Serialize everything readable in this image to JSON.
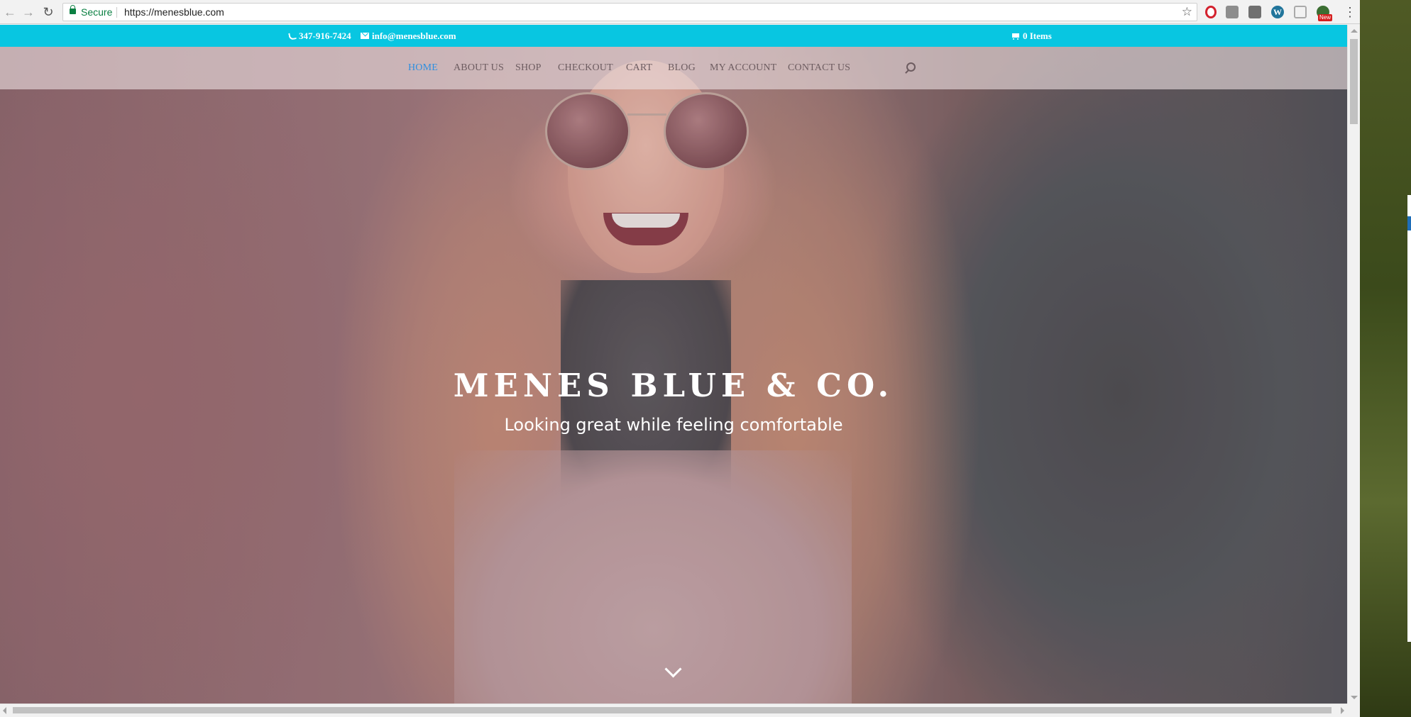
{
  "browser": {
    "secure_label": "Secure",
    "url": "https://menesblue.com",
    "extensions": [
      "opera-icon",
      "extension-icon",
      "extension-icon",
      "wordpress-icon",
      "extension-icon",
      "extension-icon"
    ],
    "new_badge": "New"
  },
  "topbar": {
    "phone": "347-916-7424",
    "email": "info@menesblue.com",
    "cart": "0 Items",
    "color": "#08c6e1"
  },
  "nav": {
    "items": [
      {
        "label": "HOME",
        "current": true
      },
      {
        "label": "ABOUT US"
      },
      {
        "label": "SHOP"
      },
      {
        "label": "CHECKOUT"
      },
      {
        "label": "CART"
      },
      {
        "label": "BLOG"
      },
      {
        "label": "MY ACCOUNT"
      },
      {
        "label": "CONTACT US"
      }
    ],
    "active_color": "#2e8fe0"
  },
  "hero": {
    "title": "MENES BLUE & CO.",
    "subtitle": "Looking great while feeling comfortable"
  }
}
